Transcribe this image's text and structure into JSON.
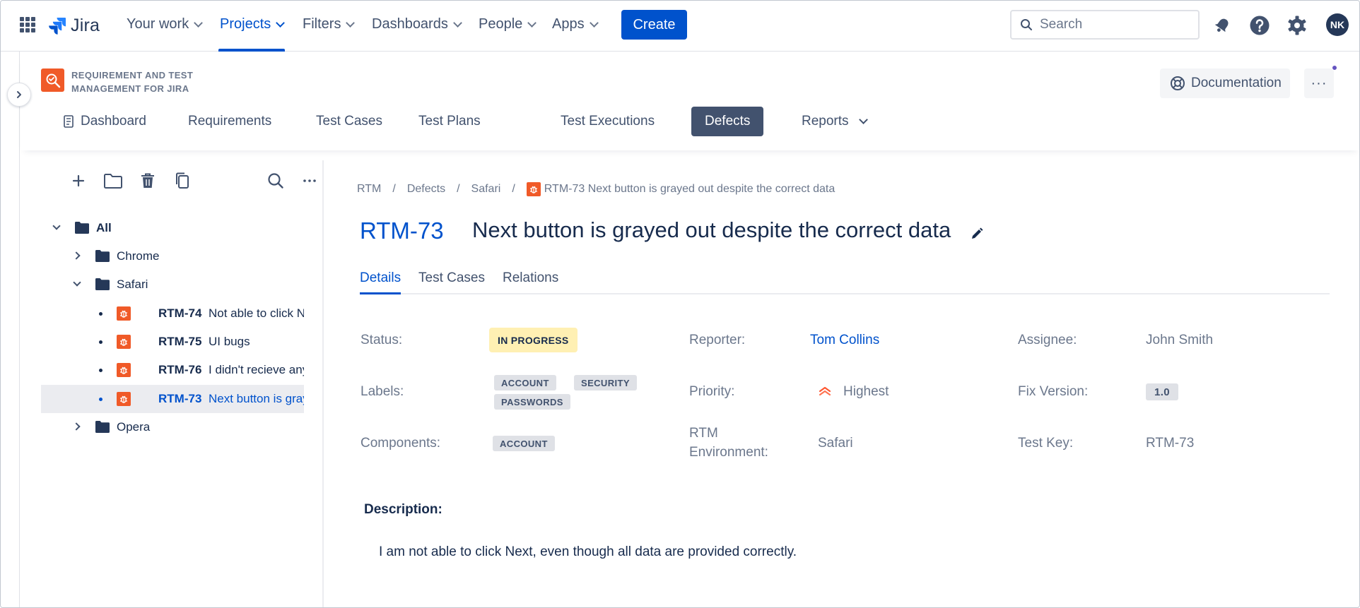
{
  "topnav": {
    "app_name": "Jira",
    "menu": [
      {
        "label": "Your work"
      },
      {
        "label": "Projects"
      },
      {
        "label": "Filters"
      },
      {
        "label": "Dashboards"
      },
      {
        "label": "People"
      },
      {
        "label": "Apps"
      }
    ],
    "active_menu": "Projects",
    "create_label": "Create",
    "search_placeholder": "Search",
    "avatar_initials": "NK",
    "icons": [
      "app-switcher-icon",
      "notification-icon",
      "help-icon",
      "settings-icon"
    ]
  },
  "app_header": {
    "title_line1": "REQUIREMENT AND TEST",
    "title_line2": "MANAGEMENT FOR JIRA",
    "documentation_label": "Documentation",
    "more_label": "···",
    "tabs": [
      {
        "label": "Dashboard"
      },
      {
        "label": "Requirements"
      },
      {
        "label": "Test Cases"
      },
      {
        "label": "Test Plans"
      },
      {
        "label": "Test Executions"
      },
      {
        "label": "Defects"
      },
      {
        "label": "Reports"
      }
    ],
    "active_tab": "Defects"
  },
  "tree": {
    "toolbar_icons": [
      "add-icon",
      "new-folder-icon",
      "delete-icon",
      "copy-icon",
      "search-icon",
      "more-icon"
    ],
    "root": "All",
    "folders": [
      {
        "label": "Chrome",
        "expanded": false
      },
      {
        "label": "Safari",
        "expanded": true
      },
      {
        "label": "Opera",
        "expanded": false
      }
    ],
    "items": [
      {
        "key": "RTM-74",
        "summary": "Not able to click Notifications"
      },
      {
        "key": "RTM-75",
        "summary": "UI bugs"
      },
      {
        "key": "RTM-76",
        "summary": "I didn't recieve any SMS"
      },
      {
        "key": "RTM-73",
        "summary": "Next button is grayed out despite the correct data",
        "selected": true
      }
    ]
  },
  "breadcrumb": {
    "items": [
      "RTM",
      "Defects",
      "Safari"
    ],
    "current": "RTM-73 Next button is grayed out despite the correct data"
  },
  "issue": {
    "key": "RTM-73",
    "title": "Next button is grayed out despite the correct data",
    "tabs": [
      {
        "label": "Details"
      },
      {
        "label": "Test Cases"
      },
      {
        "label": "Relations"
      }
    ],
    "active_tab": "Details",
    "fields": {
      "status_label": "Status:",
      "status_value": "IN PROGRESS",
      "reporter_label": "Reporter:",
      "reporter_value": "Tom Collins",
      "assignee_label": "Assignee:",
      "assignee_value": "John Smith",
      "labels_label": "Labels:",
      "labels": [
        "ACCOUNT",
        "SECURITY",
        "PASSWORDS"
      ],
      "priority_label": "Priority:",
      "priority_value": "Highest",
      "fix_version_label": "Fix Version:",
      "fix_version_value": "1.0",
      "components_label": "Components:",
      "components": [
        "ACCOUNT"
      ],
      "environment_label_line1": "RTM",
      "environment_label_line2": "Environment:",
      "environment_value": "Safari",
      "test_key_label": "Test Key:",
      "test_key_value": "RTM-73"
    },
    "description_label": "Description:",
    "description_text": "I am not able to click Next, even though all data are provided correctly."
  },
  "colors": {
    "brand_blue": "#0052cc",
    "status_bg": "#fff0b3",
    "defect_orange": "#f05a28",
    "active_tab_bg": "#42526e"
  }
}
